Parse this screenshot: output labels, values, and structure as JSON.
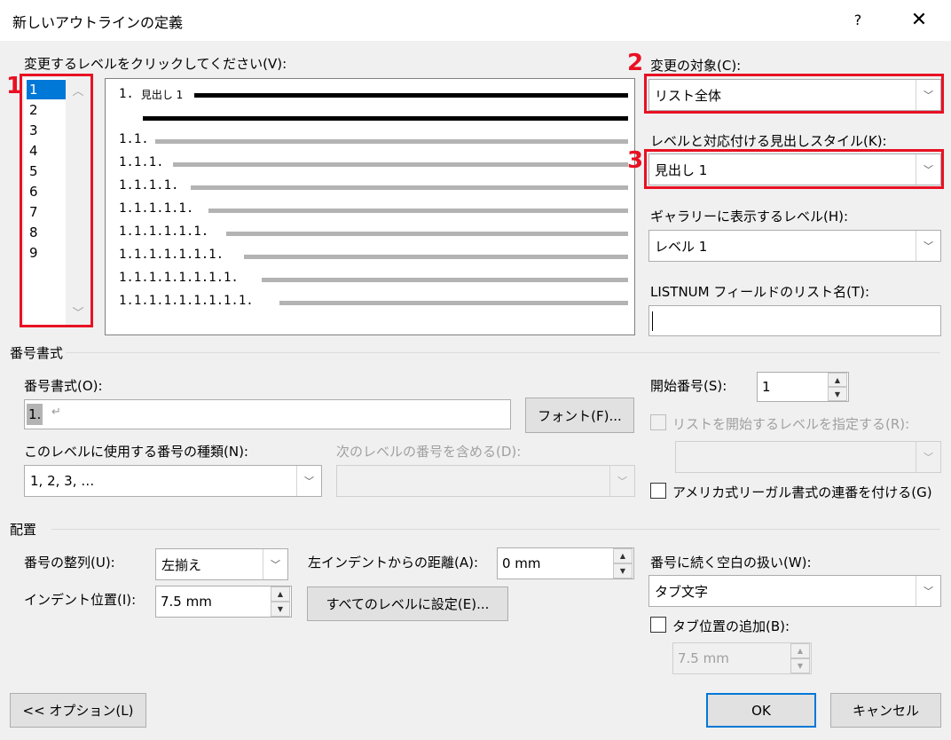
{
  "window": {
    "title": "新しいアウトラインの定義",
    "help": "?",
    "close": "✕"
  },
  "level_section": {
    "label": "変更するレベルをクリックしてください(V):",
    "levels": [
      "1",
      "2",
      "3",
      "4",
      "5",
      "6",
      "7",
      "8",
      "9"
    ],
    "selected": "1"
  },
  "preview": {
    "heading_number": "1.",
    "heading_text": "見出し 1",
    "rows": [
      "1.1.",
      "1.1.1.",
      "1.1.1.1.",
      "1.1.1.1.1.",
      "1.1.1.1.1.1.",
      "1.1.1.1.1.1.1.",
      "1.1.1.1.1.1.1.1.",
      "1.1.1.1.1.1.1.1.1."
    ]
  },
  "annotations": {
    "n1": "1",
    "n2": "2",
    "n3": "3",
    "color": "#e81123"
  },
  "right_panel": {
    "apply_to_label": "変更の対象(C):",
    "apply_to_value": "リスト全体",
    "link_style_label": "レベルと対応付ける見出しスタイル(K):",
    "link_style_value": "見出し 1",
    "gallery_label": "ギャラリーに表示するレベル(H):",
    "gallery_value": "レベル 1",
    "listnum_label": "LISTNUM フィールドのリスト名(T):",
    "listnum_value": ""
  },
  "number_format": {
    "section_title": "番号書式",
    "format_label": "番号書式(O):",
    "format_value": "1.",
    "format_mark": "↵",
    "font_button": "フォント(F)...",
    "style_label": "このレベルに使用する番号の種類(N):",
    "style_value": "1, 2, 3, …",
    "include_label": "次のレベルの番号を含める(D):",
    "include_value": "",
    "start_label": "開始番号(S):",
    "start_value": "1",
    "restart_label": "リストを開始するレベルを指定する(R):",
    "restart_value": "",
    "legal_label": "アメリカ式リーガル書式の連番を付ける(G)"
  },
  "position": {
    "section_title": "配置",
    "align_label": "番号の整列(U):",
    "align_value": "左揃え",
    "aligned_at_label": "左インデントからの距離(A):",
    "aligned_at_value": "0 mm",
    "indent_label": "インデント位置(I):",
    "indent_value": "7.5 mm",
    "set_all_button": "すべてのレベルに設定(E)...",
    "follow_label": "番号に続く空白の扱い(W):",
    "follow_value": "タブ文字",
    "tab_stop_label": "タブ位置の追加(B):",
    "tab_stop_value": "7.5 mm"
  },
  "footer": {
    "options_button": "<< オプション(L)",
    "ok_button": "OK",
    "cancel_button": "キャンセル"
  },
  "colors": {
    "accent": "#0078d7",
    "dialog_bg": "#f0f0f0",
    "highlight": "#e81123"
  }
}
